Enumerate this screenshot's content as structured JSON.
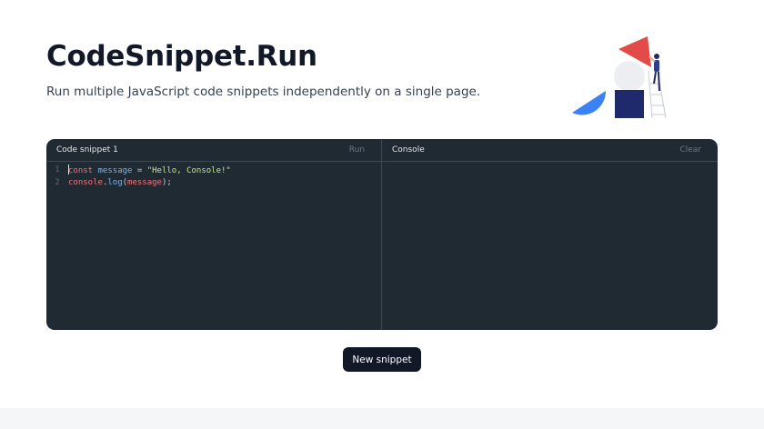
{
  "header": {
    "title": "CodeSnippet.Run",
    "subtitle": "Run multiple JavaScript code snippets independently on a single page."
  },
  "snippet": {
    "title": "Code snippet 1",
    "run_label": "Run",
    "lines": [
      {
        "number": "1",
        "tokens": [
          {
            "text": "const",
            "kind": "kw"
          },
          {
            "text": " ",
            "kind": "op"
          },
          {
            "text": "message",
            "kind": "var"
          },
          {
            "text": " = ",
            "kind": "op"
          },
          {
            "text": "\"Hello, Console!\"",
            "kind": "str"
          }
        ]
      },
      {
        "number": "2",
        "tokens": [
          {
            "text": "console",
            "kind": "kw"
          },
          {
            "text": ".",
            "kind": "op"
          },
          {
            "text": "log",
            "kind": "var"
          },
          {
            "text": "(",
            "kind": "op"
          },
          {
            "text": "message",
            "kind": "kw"
          },
          {
            "text": ");",
            "kind": "op"
          }
        ]
      }
    ]
  },
  "console": {
    "title": "Console",
    "clear_label": "Clear"
  },
  "actions": {
    "new_snippet_label": "New snippet"
  },
  "colors": {
    "editor_bg": "#202a32",
    "keyword": "#f0767e",
    "identifier": "#7cb3f0",
    "string": "#c3e88d",
    "button_bg": "#111827"
  }
}
